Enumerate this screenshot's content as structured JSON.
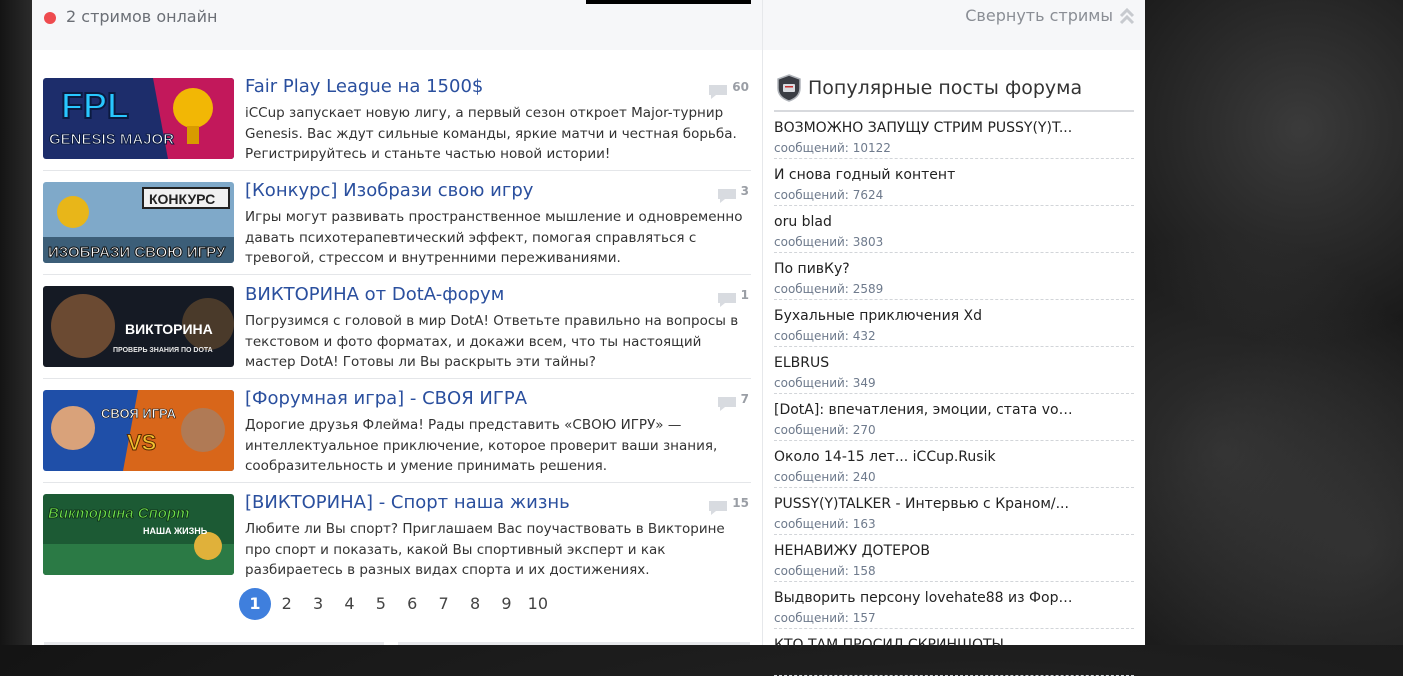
{
  "streams": {
    "online_text": "2 стримов онлайн",
    "collapse_label": "Свернуть стримы"
  },
  "news": [
    {
      "title": "Fair Play League на 1500$",
      "desc": "iCCup запускает новую лигу, а первый сезон откроет Major-турнир Genesis. Вас ждут сильные команды, яркие матчи и честная борьба. Регистрируйтесь и станьте частью новой истории!",
      "comments": "60",
      "thumb": {
        "line1": "FPL",
        "line2": "GENESIS MAJOR"
      }
    },
    {
      "title": "[Конкурс] Изобрази свою игру",
      "desc": "Игры могут развивать пространственное мышление и одновременно давать психотерапевтический эффект, помогая справляться с тревогой, стрессом и внутренними переживаниями.",
      "comments": "3",
      "thumb": {
        "line1": "КОНКУРС",
        "line2": "ИЗОБРАЗИ СВОЮ ИГРУ"
      }
    },
    {
      "title": "ВИКТОРИНА от DotA-форум",
      "desc": "Погрузимся с головой в мир DotA! Ответьте правильно на вопросы в текстовом и фото форматах, и докажи всем, что ты настоящий мастер DotA! Готовы ли Вы раскрыть эти тайны?",
      "comments": "1",
      "thumb": {
        "line1": "ВИКТОРИНА",
        "line2": "ПРОВЕРЬ ЗНАНИЯ ПО DOTA"
      }
    },
    {
      "title": "[Форумная игра] - СВОЯ ИГРА",
      "desc": "Дорогие друзья Флейма! Рады представить «СВОЮ ИГРУ» — интеллектуальное приключение, которое проверит ваши знания, сообразительность и умение принимать решения.",
      "comments": "7",
      "thumb": {
        "line1": "СВОЯ ИГРА",
        "line2": "VS"
      }
    },
    {
      "title": "[ВИКТОРИНА] - Спорт наша жизнь",
      "desc": "Любите ли Вы спорт? Приглашаем Вас поучаствовать в Викторине про спорт и показать, какой Вы спортивный эксперт и как разбираетесь в разных видах спорта и их достижениях.",
      "comments": "15",
      "thumb": {
        "line1": "Викторина Спорт",
        "line2": "НАША ЖИЗНЬ"
      }
    }
  ],
  "pagination": {
    "pages": [
      "1",
      "2",
      "3",
      "4",
      "5",
      "6",
      "7",
      "8",
      "9",
      "10"
    ],
    "active": "1"
  },
  "forum": {
    "title": "Популярные посты форума",
    "count_prefix": "сообщений:",
    "posts": [
      {
        "title": "ВОЗМОЖНО ЗАПУЩУ СТРИМ PUSSY(Y)T...",
        "count": "10122"
      },
      {
        "title": "И снова годный контент",
        "count": "7624"
      },
      {
        "title": "oru blad",
        "count": "3803"
      },
      {
        "title": "По пивКу?",
        "count": "2589"
      },
      {
        "title": "Бухальные приключения Xd",
        "count": "432"
      },
      {
        "title": "ELBRUS",
        "count": "349"
      },
      {
        "title": "[DotA]: впечатления, эмоции, стата vol ...",
        "count": "270"
      },
      {
        "title": "Около 14-15 лет... iCCup.Rusik",
        "count": "240"
      },
      {
        "title": "PUSSY(Y)TALKER - Интервью с Краном/...",
        "count": "163"
      },
      {
        "title": "НЕНАВИЖУ ДОТЕРОВ",
        "count": "158"
      },
      {
        "title": "Выдворить персону lovehate88 из Фору...",
        "count": "157"
      },
      {
        "title": "КТО ТАМ ПРОСИЛ СКРИНШОТЫ",
        "count": ""
      }
    ]
  },
  "colors": {
    "accent": "#3f7fdd",
    "title_link": "#2a4f9e",
    "live_dot": "#ee4b4f"
  },
  "icons": {
    "live": "live-dot-icon",
    "collapse": "chevron-double-up-icon",
    "comments": "comment-bubble-icon",
    "forum": "forum-shield-icon"
  }
}
